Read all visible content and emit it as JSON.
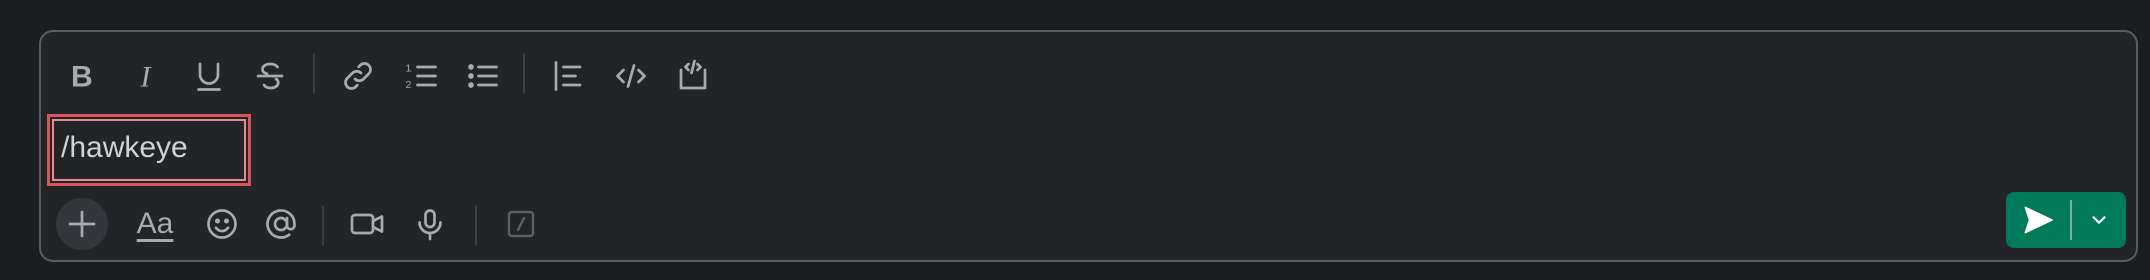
{
  "composer": {
    "message_text": "/hawkeye"
  },
  "toolbar": {
    "buttons": [
      {
        "name": "bold-icon"
      },
      {
        "name": "italic-icon"
      },
      {
        "name": "underline-icon"
      },
      {
        "name": "strikethrough-icon"
      },
      {
        "name": "link-icon"
      },
      {
        "name": "ordered-list-icon"
      },
      {
        "name": "bulleted-list-icon"
      },
      {
        "name": "blockquote-icon"
      },
      {
        "name": "code-icon"
      },
      {
        "name": "code-block-icon"
      }
    ]
  },
  "bottom_bar": {
    "format_label": "Aa",
    "icons": [
      "plus-icon",
      "format-icon",
      "emoji-icon",
      "mention-icon",
      "video-icon",
      "microphone-icon",
      "slash-command-icon"
    ]
  },
  "send": {
    "button_color": "#007a5a",
    "icons": [
      "send-icon",
      "chevron-down-icon"
    ]
  },
  "colors": {
    "background": "#1b1d21",
    "composer_bg": "#222428",
    "icon": "#a9aaad",
    "highlight": "#d8555c"
  }
}
